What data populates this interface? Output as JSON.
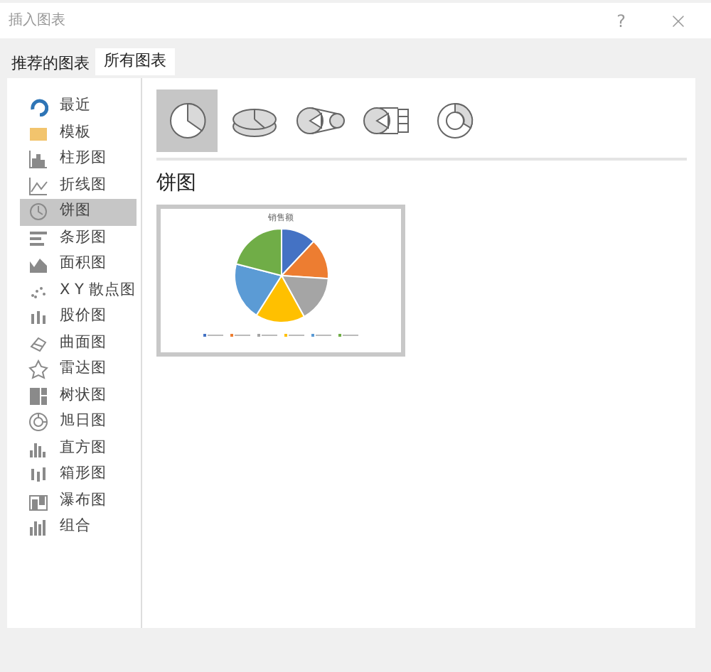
{
  "window": {
    "title": "插入图表",
    "help": "?"
  },
  "tabs": [
    {
      "label": "推荐的图表",
      "selected": false
    },
    {
      "label": "所有图表",
      "selected": true
    }
  ],
  "sidebar": {
    "items": [
      {
        "label": "最近",
        "selected": false
      },
      {
        "label": "模板",
        "selected": false
      },
      {
        "label": "柱形图",
        "selected": false
      },
      {
        "label": "折线图",
        "selected": false
      },
      {
        "label": "饼图",
        "selected": true
      },
      {
        "label": "条形图",
        "selected": false
      },
      {
        "label": "面积图",
        "selected": false
      },
      {
        "label": "X Y 散点图",
        "selected": false
      },
      {
        "label": "股价图",
        "selected": false
      },
      {
        "label": "曲面图",
        "selected": false
      },
      {
        "label": "雷达图",
        "selected": false
      },
      {
        "label": "树状图",
        "selected": false
      },
      {
        "label": "旭日图",
        "selected": false
      },
      {
        "label": "直方图",
        "selected": false
      },
      {
        "label": "箱形图",
        "selected": false
      },
      {
        "label": "瀑布图",
        "selected": false
      },
      {
        "label": "组合",
        "selected": false
      }
    ]
  },
  "subtypes": [
    {
      "kind": "pie",
      "selected": true
    },
    {
      "kind": "pie3d",
      "selected": false
    },
    {
      "kind": "pieofpie",
      "selected": false
    },
    {
      "kind": "barofpie",
      "selected": false
    },
    {
      "kind": "doughnut",
      "selected": false
    }
  ],
  "heading": "饼图",
  "preview": {
    "title": "销售额"
  }
}
